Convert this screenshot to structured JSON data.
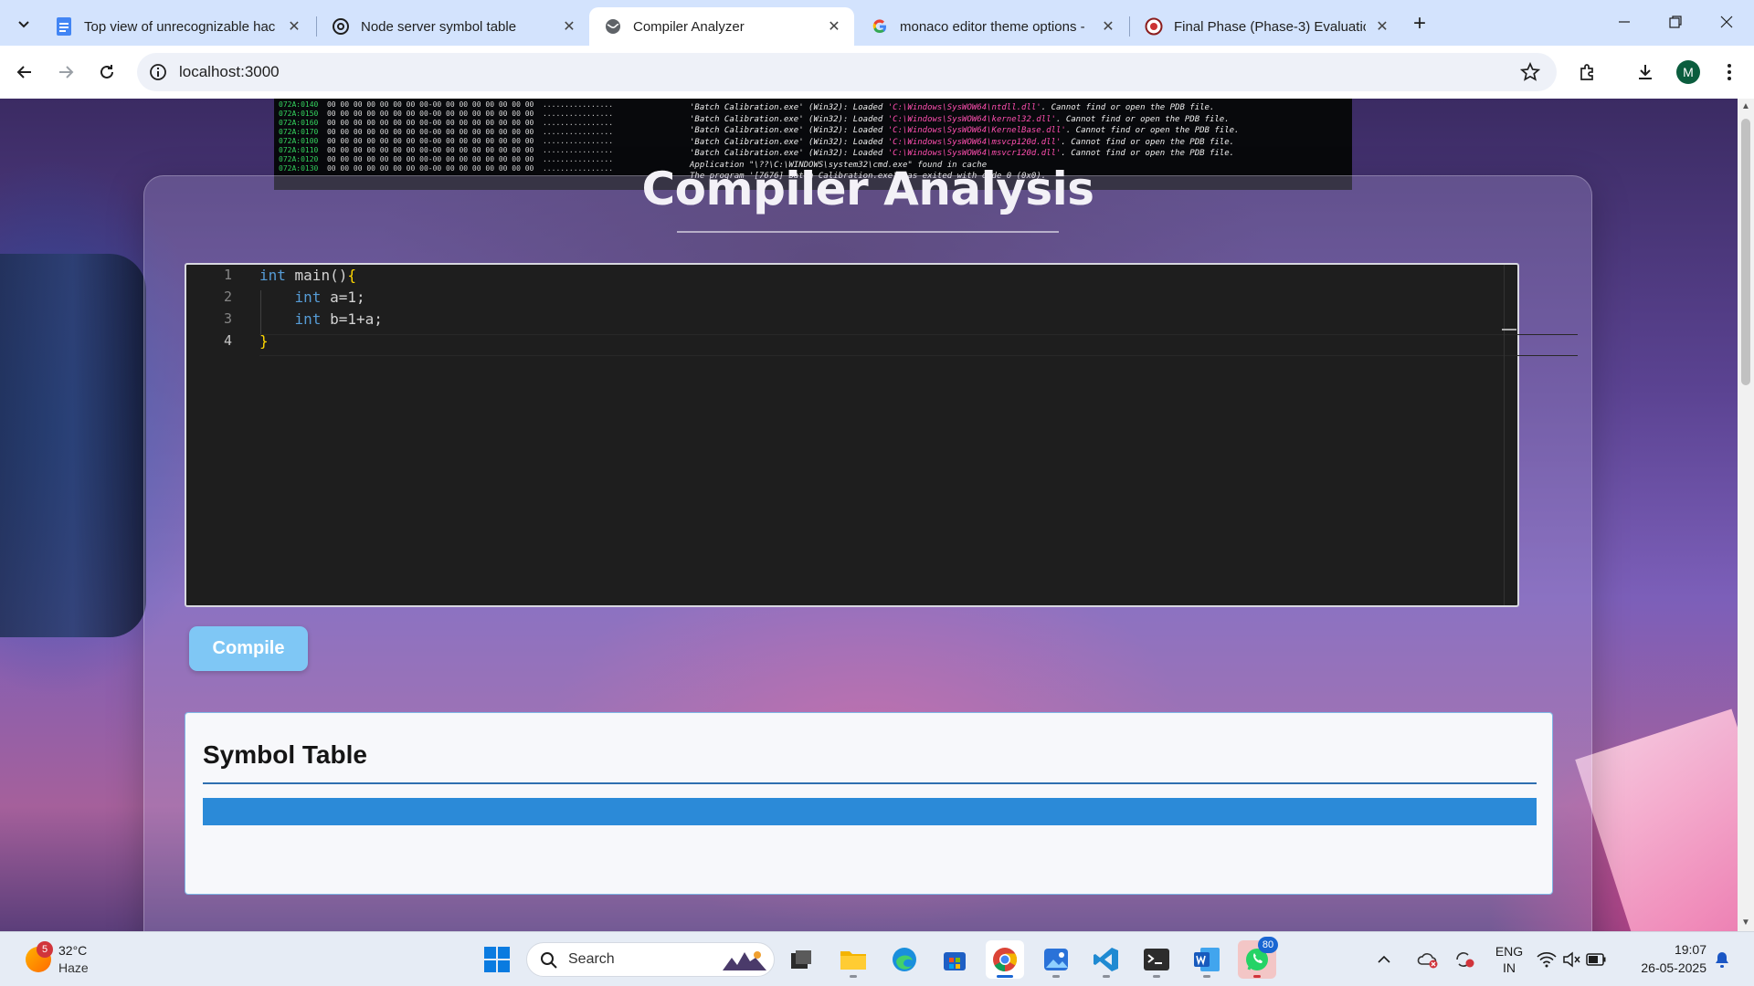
{
  "browser": {
    "tabs": [
      {
        "title": "Top view of unrecognizable hac",
        "active": false
      },
      {
        "title": "Node server symbol table",
        "active": false
      },
      {
        "title": "Compiler Analyzer",
        "active": true
      },
      {
        "title": "monaco editor theme options -",
        "active": false
      },
      {
        "title": "Final Phase (Phase-3) Evaluatio",
        "active": false
      }
    ],
    "url": "localhost:3000",
    "profile_initial": "M"
  },
  "background_screen": {
    "hex_rows": [
      {
        "addr": "072A:0140",
        "bytes": "00 00 00 00 00 00 00 00-00 00 00 00 00 00 00 00",
        "ascii": "................"
      },
      {
        "addr": "072A:0150",
        "bytes": "00 00 00 00 00 00 00 00-00 00 00 00 00 00 00 00",
        "ascii": "................"
      },
      {
        "addr": "072A:0160",
        "bytes": "00 00 00 00 00 00 00 00-00 00 00 00 00 00 00 00",
        "ascii": "................"
      },
      {
        "addr": "072A:0170",
        "bytes": "00 00 00 00 00 00 00 00-00 00 00 00 00 00 00 00",
        "ascii": "................"
      },
      {
        "addr": "072A:0100",
        "bytes": "00 00 00 00 00 00 00 00-00 00 00 00 00 00 00 00",
        "ascii": "................"
      },
      {
        "addr": "072A:0110",
        "bytes": "00 00 00 00 00 00 00 00-00 00 00 00 00 00 00 00",
        "ascii": "................"
      },
      {
        "addr": "072A:0120",
        "bytes": "00 00 00 00 00 00 00 00-00 00 00 00 00 00 00 00",
        "ascii": "................"
      },
      {
        "addr": "072A:0130",
        "bytes": "00 00 00 00 00 00 00 00-00 00 00 00 00 00 00 00",
        "ascii": "................"
      }
    ],
    "log_lines": [
      {
        "pre": "'Batch Calibration.exe' (Win32): Loaded ",
        "path": "'C:\\Windows\\SysWOW64\\ntdll.dll'",
        "post": ". Cannot find or open the PDB file."
      },
      {
        "pre": "'Batch Calibration.exe' (Win32): Loaded ",
        "path": "'C:\\Windows\\SysWOW64\\kernel32.dll'",
        "post": ". Cannot find or open the PDB file."
      },
      {
        "pre": "'Batch Calibration.exe' (Win32): Loaded ",
        "path": "'C:\\Windows\\SysWOW64\\KernelBase.dll'",
        "post": ". Cannot find or open the PDB file."
      },
      {
        "pre": "'Batch Calibration.exe' (Win32): Loaded ",
        "path": "'C:\\Windows\\SysWOW64\\msvcp120d.dll'",
        "post": ". Cannot find or open the PDB file."
      },
      {
        "pre": "'Batch Calibration.exe' (Win32): Loaded ",
        "path": "'C:\\Windows\\SysWOW64\\msvcr120d.dll'",
        "post": ". Cannot find or open the PDB file."
      },
      {
        "pre": "Application \"\\??\\C:\\WINDOWS\\system32\\cmd.exe\" found in cache",
        "path": "",
        "post": ""
      },
      {
        "pre": "The program '[7676] Batch Calibration.exe' has exited with code 0 (0x0).",
        "path": "",
        "post": ""
      }
    ]
  },
  "page": {
    "title": "Compiler Analysis",
    "compile_label": "Compile",
    "symbol_table_title": "Symbol Table"
  },
  "editor": {
    "lines": [
      {
        "num": "1",
        "indent": "",
        "kw": "int",
        "rest": " main()",
        "brace": "{"
      },
      {
        "num": "2",
        "indent": "    ",
        "kw": "int",
        "rest": " a=1;",
        "brace": ""
      },
      {
        "num": "3",
        "indent": "    ",
        "kw": "int",
        "rest": " b=1+a;",
        "brace": ""
      },
      {
        "num": "4",
        "indent": "",
        "kw": "",
        "rest": "",
        "brace": "}"
      }
    ]
  },
  "taskbar": {
    "weather_badge": "5",
    "temperature": "32°C",
    "condition": "Haze",
    "search_label": "Search",
    "whatsapp_badge": "80",
    "language_top": "ENG",
    "language_bottom": "IN",
    "time": "19:07",
    "date": "26-05-2025"
  }
}
